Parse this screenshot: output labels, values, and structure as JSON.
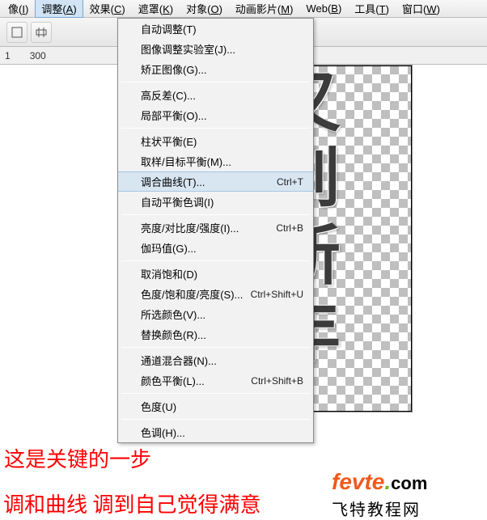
{
  "menubar": [
    {
      "label": "像(I)",
      "key": "I"
    },
    {
      "label": "调整(A)",
      "key": "A",
      "active": true
    },
    {
      "label": "效果(C)",
      "key": "C"
    },
    {
      "label": "遮罩(K)",
      "key": "K"
    },
    {
      "label": "对象(O)",
      "key": "O"
    },
    {
      "label": "动画影片(M)",
      "key": "M"
    },
    {
      "label": "Web(B)",
      "key": "B"
    },
    {
      "label": "工具(T)",
      "key": "T"
    },
    {
      "label": "窗口(W)",
      "key": "W"
    }
  ],
  "ruler": {
    "a": "1",
    "b": "300"
  },
  "dropdown": [
    {
      "label": "自动调整(T)"
    },
    {
      "label": "图像调整实验室(J)..."
    },
    {
      "label": "矫正图像(G)..."
    },
    {
      "sep": true
    },
    {
      "label": "高反差(C)..."
    },
    {
      "label": "局部平衡(O)..."
    },
    {
      "sep": true
    },
    {
      "label": "柱状平衡(E)"
    },
    {
      "label": "取样/目标平衡(M)..."
    },
    {
      "label": "调合曲线(T)...",
      "shortcut": "Ctrl+T",
      "hl": true
    },
    {
      "label": "自动平衡色调(I)"
    },
    {
      "sep": true
    },
    {
      "label": "亮度/对比度/强度(I)...",
      "shortcut": "Ctrl+B"
    },
    {
      "label": "伽玛值(G)..."
    },
    {
      "sep": true
    },
    {
      "label": "取消饱和(D)"
    },
    {
      "label": "色度/饱和度/亮度(S)...",
      "shortcut": "Ctrl+Shift+U"
    },
    {
      "label": "所选颜色(V)..."
    },
    {
      "label": "替换颜色(R)..."
    },
    {
      "sep": true
    },
    {
      "label": "通道混合器(N)..."
    },
    {
      "label": "颜色平衡(L)...",
      "shortcut": "Ctrl+Shift+B"
    },
    {
      "sep": true
    },
    {
      "label": "色度(U)"
    },
    {
      "sep": true
    },
    {
      "label": "色调(H)..."
    }
  ],
  "canvas_chars": [
    "又",
    "到",
    "新",
    "年"
  ],
  "red_text_1": "这是关键的一步",
  "red_text_2": "调和曲线 调到自己觉得满意",
  "watermark": {
    "brand": "fevte",
    "dot": ".",
    "ext": "com",
    "sub": "飞特教程网"
  }
}
